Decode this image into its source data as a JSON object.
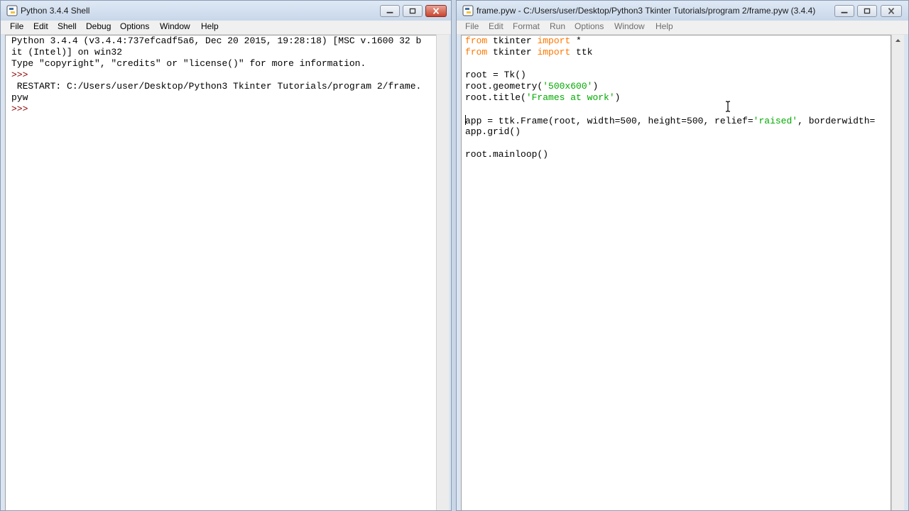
{
  "shell": {
    "title": "Python 3.4.4 Shell",
    "menu": [
      "File",
      "Edit",
      "Shell",
      "Debug",
      "Options",
      "Window",
      "Help"
    ],
    "lines": [
      "Python 3.4.4 (v3.4.4:737efcadf5a6, Dec 20 2015, 19:28:18) [MSC v.1600 32 b",
      "it (Intel)] on win32",
      "Type \"copyright\", \"credits\" or \"license()\" for more information.",
      ">>> ",
      " RESTART: C:/Users/user/Desktop/Python3 Tkinter Tutorials/program 2/frame.",
      "pyw",
      ">>> "
    ]
  },
  "editor": {
    "title": "frame.pyw - C:/Users/user/Desktop/Python3 Tkinter Tutorials/program 2/frame.pyw (3.4.4)",
    "menu": [
      "File",
      "Edit",
      "Format",
      "Run",
      "Options",
      "Window",
      "Help"
    ],
    "code": {
      "l1_kw1": "from",
      "l1_mid": " tkinter ",
      "l1_kw2": "import",
      "l1_end": " *",
      "l2_kw1": "from",
      "l2_mid": " tkinter ",
      "l2_kw2": "import",
      "l2_end": " ttk",
      "l4": "root = Tk()",
      "l5_pre": "root.geometry(",
      "l5_str": "'500x600'",
      "l5_post": ")",
      "l6_pre": "root.title(",
      "l6_str": "'Frames at work'",
      "l6_post": ")",
      "l8_pre": "app = ttk.Frame(root, width=500, height=500, relief=",
      "l8_str": "'raised'",
      "l8_post": ", borderwidth=",
      "l9": "app.grid()",
      "l11": "root.mainloop()"
    }
  },
  "colors": {
    "keyword": "#ff7700",
    "string": "#00aa00",
    "prompt": "#8b0000",
    "text": "#000000"
  }
}
